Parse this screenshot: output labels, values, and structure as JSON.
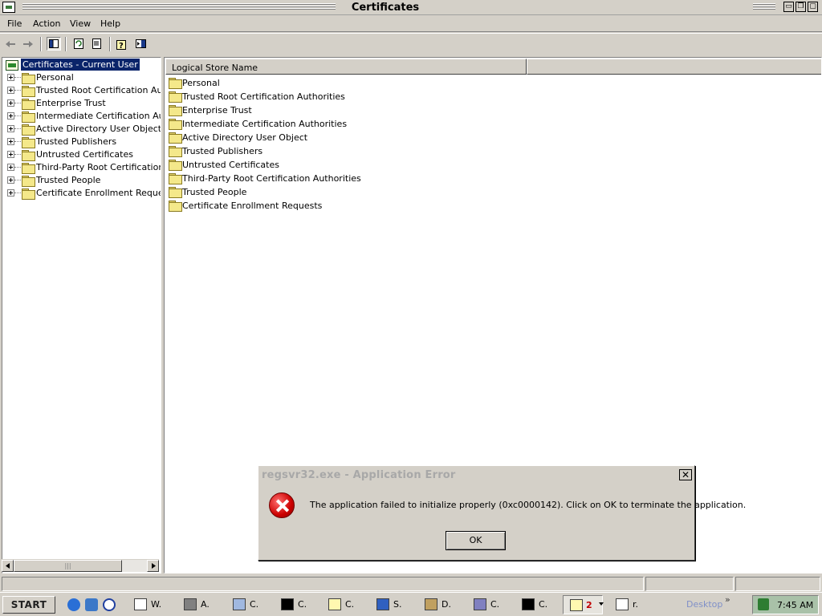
{
  "window": {
    "title": "Certificates",
    "controls": {
      "minimize": "▭",
      "restore": "❐",
      "close": "▢"
    }
  },
  "menu": [
    "File",
    "Action",
    "View",
    "Help"
  ],
  "toolbar": {
    "icons": [
      "back-arrow-icon",
      "forward-arrow-icon",
      "show-hide-tree-icon",
      "refresh-icon",
      "export-list-icon",
      "help-icon",
      "show-hide-action-pane-icon"
    ]
  },
  "tree": {
    "root": "Certificates - Current User",
    "items": [
      "Personal",
      "Trusted Root Certification Authorities",
      "Enterprise Trust",
      "Intermediate Certification Authorities",
      "Active Directory User Object",
      "Trusted Publishers",
      "Untrusted Certificates",
      "Third-Party Root Certification Authorities",
      "Trusted People",
      "Certificate Enrollment Requests"
    ],
    "scrollbar_thumb_glyph": "|||"
  },
  "list": {
    "column_header": "Logical Store Name",
    "items": [
      "Personal",
      "Trusted Root Certification Authorities",
      "Enterprise Trust",
      "Intermediate Certification Authorities",
      "Active Directory User Object",
      "Trusted Publishers",
      "Untrusted Certificates",
      "Third-Party Root Certification Authorities",
      "Trusted People",
      "Certificate Enrollment Requests"
    ]
  },
  "dialog": {
    "title": "regsvr32.exe - Application Error",
    "close": "✕",
    "message": "The application failed to initialize properly (0xc0000142). Click on OK to terminate the application.",
    "ok_label": "OK",
    "icon": "error-icon"
  },
  "taskbar": {
    "start_label": "START",
    "tasks": [
      "W.",
      "A.",
      "C.",
      "C.",
      "C.",
      "S.",
      "D.",
      "C.",
      "C.",
      "r."
    ],
    "active_count": "2",
    "desktop_label": "Desktop",
    "chevron": "»",
    "clock": "7:45 AM"
  },
  "colors": {
    "face": "#d4d0c8",
    "selection": "#0a246a",
    "folder": "#f4e88a",
    "error_red": "#cc0000",
    "tray": "#a9c1a8"
  }
}
